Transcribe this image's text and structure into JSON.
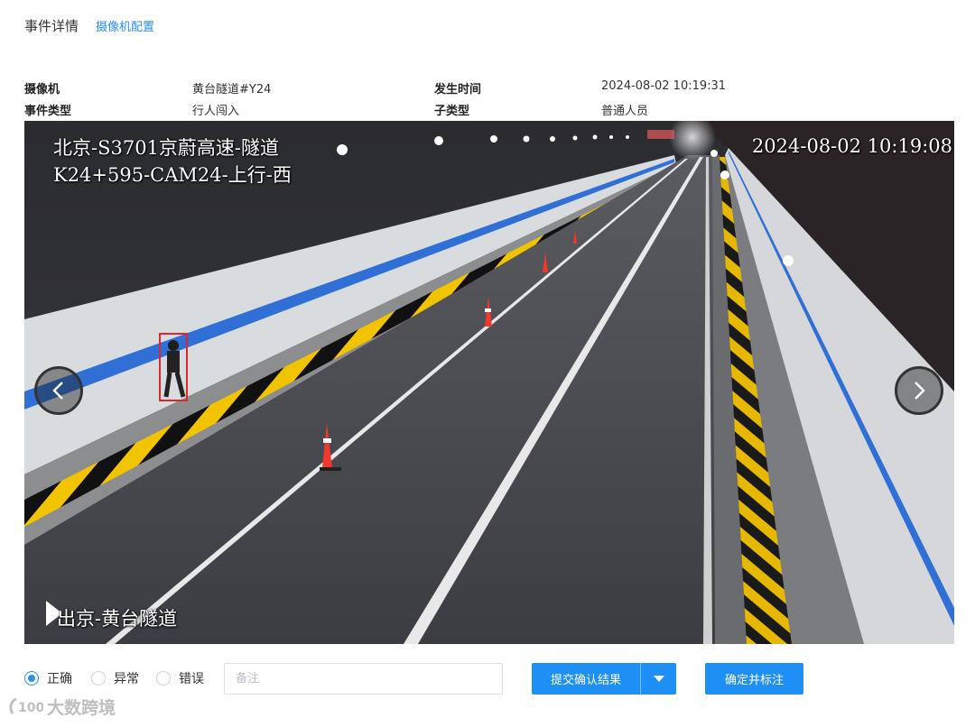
{
  "header": {
    "title": "事件详情",
    "camera_config_link": "摄像机配置"
  },
  "info": {
    "camera_label": "摄像机",
    "camera_value": "黄台隧道#Y24",
    "time_label": "发生时间",
    "time_value": "2024-08-02 10:19:31",
    "event_type_label": "事件类型",
    "event_type_value": "行人闯入",
    "subtype_label": "子类型",
    "subtype_value": "普通人员"
  },
  "video": {
    "osd_line1": "北京-S3701京蔚高速-隧道",
    "osd_line2": "K24+595-CAM24-上行-西",
    "osd_timestamp": "2024-08-02 10:19:08",
    "osd_bottom": "出京-黄台隧道",
    "prev_icon": "chevron-left-icon",
    "next_icon": "chevron-right-icon",
    "detection_box_color": "#e0262a"
  },
  "controls": {
    "radios": [
      {
        "label": "正确",
        "checked": true
      },
      {
        "label": "异常",
        "checked": false
      },
      {
        "label": "错误",
        "checked": false
      }
    ],
    "remark_placeholder": "备注",
    "remark_value": "",
    "submit_label": "提交确认结果",
    "confirm_label": "确定并标注"
  },
  "watermark": {
    "text": "大数跨境"
  },
  "colors": {
    "accent": "#1e8ff5",
    "link": "#2a8ef2"
  }
}
